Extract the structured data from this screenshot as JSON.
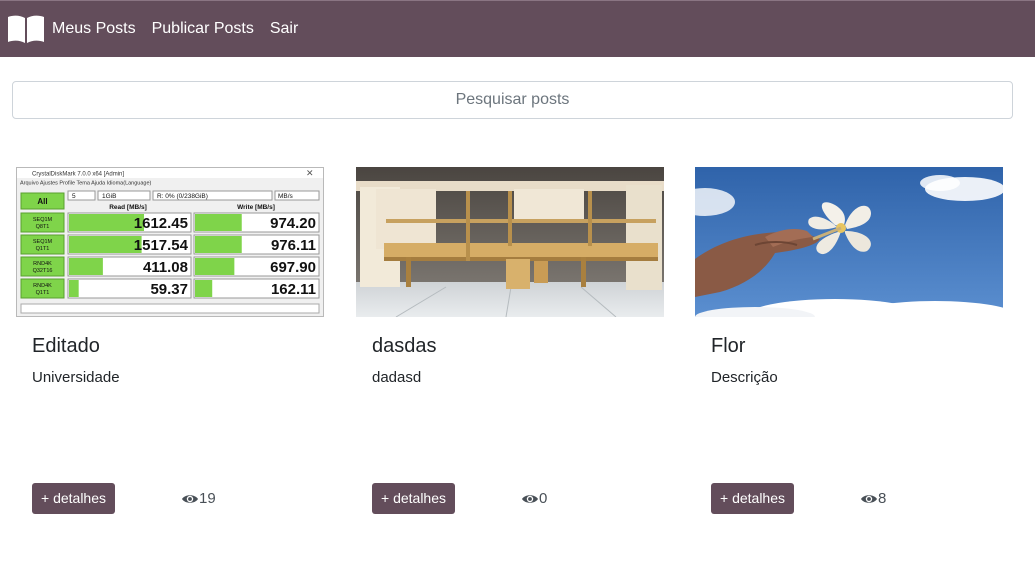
{
  "nav": {
    "brand_icon": "open-book-icon",
    "links": [
      "Meus Posts",
      "Publicar Posts",
      "Sair"
    ]
  },
  "search": {
    "placeholder": "Pesquisar posts",
    "value": ""
  },
  "posts": [
    {
      "title": "Editado",
      "description": "Universidade",
      "button_label": "+ detalhes",
      "views": "19",
      "image_icon": "benchmark-screenshot",
      "image_text": {
        "window_title": "CrystalDiskMark 7.0.0 x64 [Admin]",
        "menu": "Arquivo  Ajustes  Profile  Tema  Ajuda  Idioma(Language)",
        "all_label": "All",
        "count": "5",
        "size": "1GiB",
        "drive": "R: 0% (0/238GiB)",
        "unit": "MB/s",
        "read_header": "Read [MB/s]",
        "write_header": "Write [MB/s]",
        "rows": [
          {
            "label1": "SEQ1M",
            "label2": "Q8T1",
            "read": "1612.45",
            "write": "974.20",
            "read_frac": 0.62,
            "write_frac": 0.38
          },
          {
            "label1": "SEQ1M",
            "label2": "Q1T1",
            "read": "1517.54",
            "write": "976.11",
            "read_frac": 0.6,
            "write_frac": 0.38
          },
          {
            "label1": "RND4K",
            "label2": "Q32T16",
            "read": "411.08",
            "write": "697.90",
            "read_frac": 0.28,
            "write_frac": 0.32
          },
          {
            "label1": "RND4K",
            "label2": "Q1T1",
            "read": "59.37",
            "write": "162.11",
            "read_frac": 0.08,
            "write_frac": 0.14
          }
        ]
      }
    },
    {
      "title": "dasdas",
      "description": "dadasd",
      "button_label": "+ detalhes",
      "views": "0",
      "image_icon": "furniture-photo"
    },
    {
      "title": "Flor",
      "description": "Descrição",
      "button_label": "+ detalhes",
      "views": "8",
      "image_icon": "flower-photo"
    }
  ],
  "colors": {
    "primary": "#634d5b",
    "sky": "#3f74b8",
    "bar_green": "#7fd44a"
  }
}
